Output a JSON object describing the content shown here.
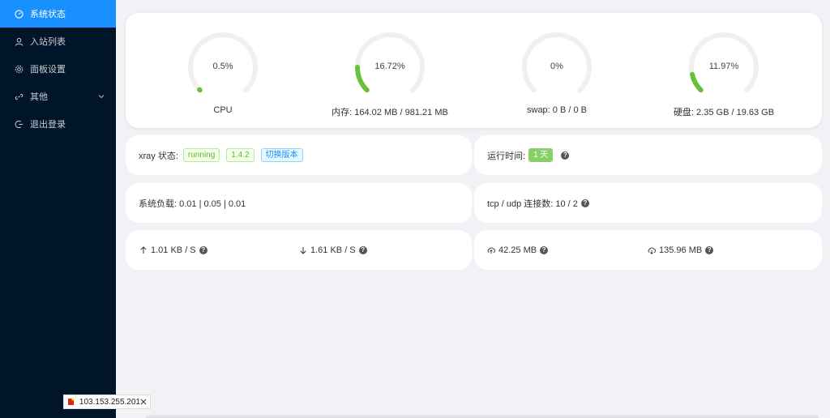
{
  "menu": {
    "items": [
      {
        "label": "系统状态",
        "icon": "dashboard-icon"
      },
      {
        "label": "入站列表",
        "icon": "user-icon"
      },
      {
        "label": "面板设置",
        "icon": "gear-icon"
      },
      {
        "label": "其他",
        "icon": "link-icon"
      },
      {
        "label": "退出登录",
        "icon": "logout-icon"
      }
    ]
  },
  "gauges": [
    {
      "percent_text": "0.5%",
      "percent": 0.5,
      "label": "CPU"
    },
    {
      "percent_text": "16.72%",
      "percent": 16.72,
      "label": "内存: 164.02 MB / 981.21 MB"
    },
    {
      "percent_text": "0%",
      "percent": 0,
      "label": "swap: 0 B / 0 B"
    },
    {
      "percent_text": "11.97%",
      "percent": 11.97,
      "label": "硬盘: 2.35 GB / 19.63 GB"
    }
  ],
  "xray": {
    "label": "xray 状态:",
    "status": "running",
    "version": "1.4.2",
    "switch_label": "切换版本"
  },
  "uptime": {
    "label": "运行时间:",
    "value": "1 天"
  },
  "load": {
    "text": "系统负载: 0.01 | 0.05 | 0.01"
  },
  "connections": {
    "text": "tcp / udp 连接数: 10 / 2"
  },
  "net": {
    "up_speed": "1.01 KB / S",
    "down_speed": "1.61 KB / S"
  },
  "traffic": {
    "sent": "42.25 MB",
    "received": "135.96 MB"
  },
  "ip_bar": {
    "ip": "103.153.255.201"
  },
  "colors": {
    "accent": "#1890ff",
    "sidebar": "#001529",
    "gauge_fill": "#67c23a",
    "gauge_track": "#f0f0f0"
  }
}
